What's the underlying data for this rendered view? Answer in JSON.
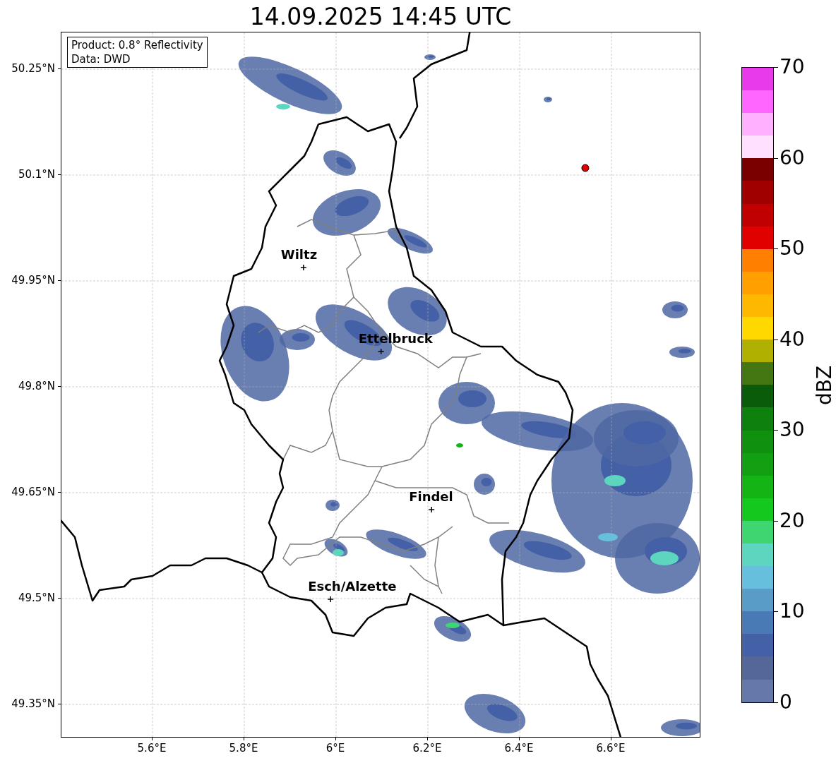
{
  "title": "14.09.2025 14:45 UTC",
  "legend": {
    "lines": [
      "Product: 0.8° Reflectivity",
      "Data: DWD"
    ]
  },
  "map": {
    "y_ticks": [
      {
        "label": "50.25°N"
      },
      {
        "label": "50.1°N"
      },
      {
        "label": "49.95°N"
      },
      {
        "label": "49.8°N"
      },
      {
        "label": "49.65°N"
      },
      {
        "label": "49.5°N"
      },
      {
        "label": "49.35°N"
      }
    ],
    "x_ticks": [
      {
        "label": "5.6°E"
      },
      {
        "label": "5.8°E"
      },
      {
        "label": "6°E"
      },
      {
        "label": "6.2°E"
      },
      {
        "label": "6.4°E"
      },
      {
        "label": "6.6°E"
      }
    ],
    "markers": [
      {
        "color": "#e00000"
      }
    ],
    "cities": [
      {
        "name": "Wiltz"
      },
      {
        "name": "Ettelbruck"
      },
      {
        "name": "Findel"
      },
      {
        "name": "Esch/Alzette"
      }
    ]
  },
  "colorbar": {
    "label": "dBZ",
    "ticks": [
      "70",
      "60",
      "50",
      "40",
      "30",
      "20",
      "10",
      "0"
    ],
    "bins": [
      {
        "color": "#e83ae8"
      },
      {
        "color": "#ff66ff"
      },
      {
        "color": "#ffb0ff"
      },
      {
        "color": "#ffe0ff"
      },
      {
        "color": "#7a0000"
      },
      {
        "color": "#a00000"
      },
      {
        "color": "#c00000"
      },
      {
        "color": "#e00000"
      },
      {
        "color": "#ff8000"
      },
      {
        "color": "#ff9f00"
      },
      {
        "color": "#ffb800"
      },
      {
        "color": "#ffd800"
      },
      {
        "color": "#b0b000"
      },
      {
        "color": "#447711"
      },
      {
        "color": "#0a5c0a"
      },
      {
        "color": "#0e800e"
      },
      {
        "color": "#0f900f"
      },
      {
        "color": "#12a012"
      },
      {
        "color": "#14b414"
      },
      {
        "color": "#14c81e"
      },
      {
        "color": "#3dd670"
      },
      {
        "color": "#5dd6c0"
      },
      {
        "color": "#66c0dd"
      },
      {
        "color": "#5a9cc8"
      },
      {
        "color": "#4a7ab5"
      },
      {
        "color": "#4460a6"
      },
      {
        "color": "#556699"
      },
      {
        "color": "#6677aa"
      }
    ]
  }
}
